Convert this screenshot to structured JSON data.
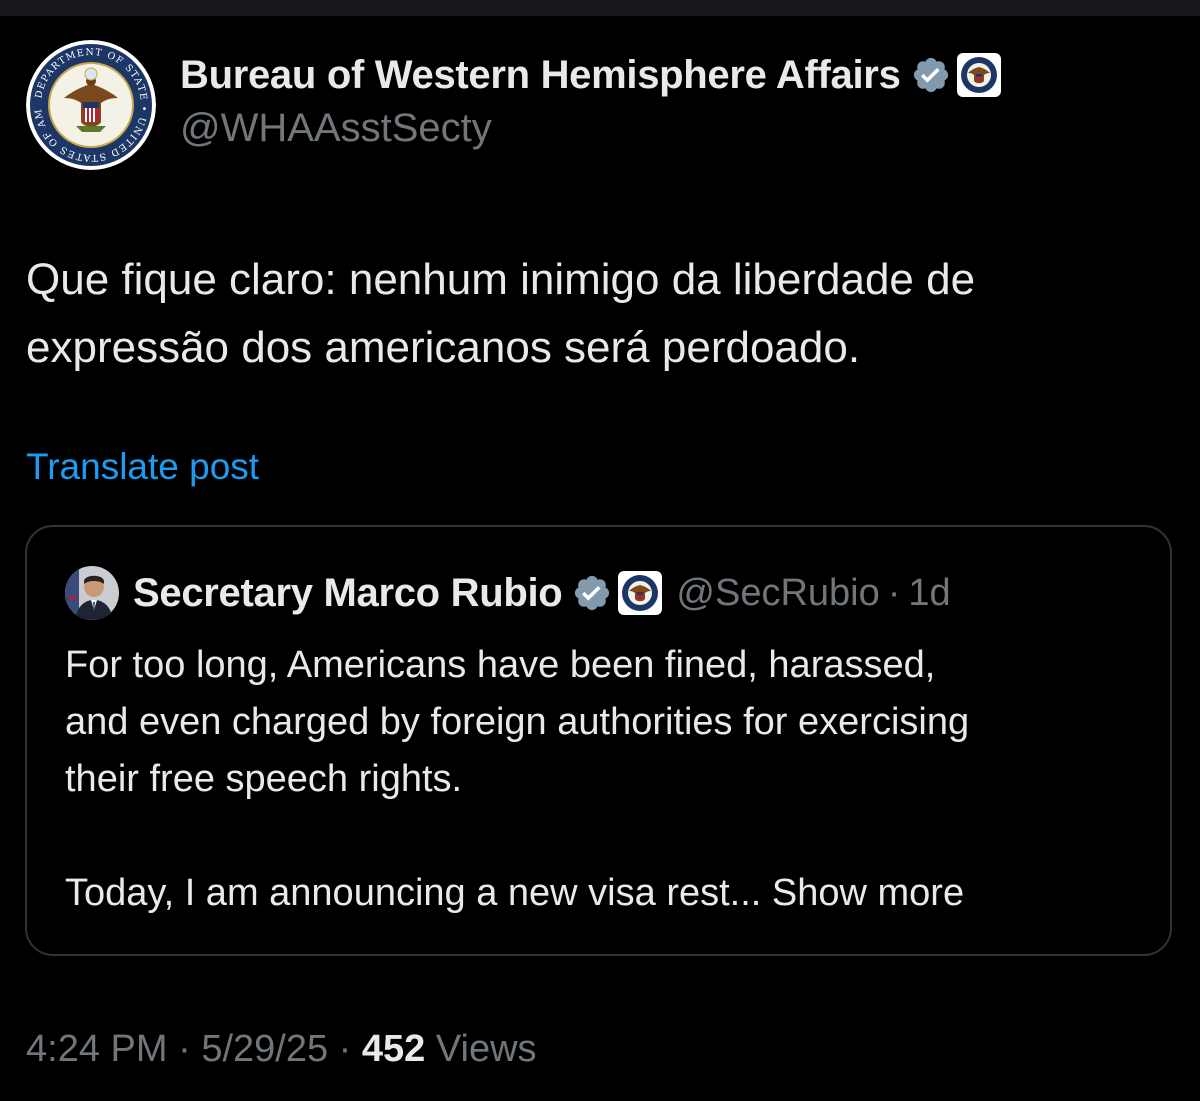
{
  "post": {
    "author": {
      "name": "Bureau of Western Hemisphere Affairs",
      "handle": "@WHAAsstSecty",
      "avatar_icon": "department-of-state-seal-icon",
      "avatar_ring_text": "DEPARTMENT OF STATE • UNITED STATES OF AMERICA",
      "verified_icon": "verified-badge-icon",
      "affiliation_icon": "state-department-seal-icon"
    },
    "text_line_1": "Que fique claro: nenhum inimigo da liberdade de",
    "text_line_2": "expressão dos americanos será perdoado.",
    "translate_label": "Translate post",
    "quoted": {
      "name": "Secretary Marco Rubio",
      "handle": "@SecRubio",
      "separator": "·",
      "time": "1d",
      "avatar_icon": "profile-photo-icon",
      "verified_icon": "verified-badge-icon",
      "affiliation_icon": "state-department-seal-icon",
      "text_line_1": "For too long, Americans have been fined, harassed,",
      "text_line_2": "and even charged by foreign authorities for exercising",
      "text_line_3": "their free speech rights.",
      "text_line_4": "Today, I am announcing a new visa rest... ",
      "show_more_label": "Show more"
    },
    "meta": {
      "time": "4:24 PM",
      "separator": "·",
      "date": "5/29/25",
      "views_count": "452",
      "views_label": "Views"
    }
  },
  "colors": {
    "background": "#000000",
    "text_primary": "#e7e9ea",
    "text_secondary": "#71767b",
    "link": "#1d9bf0",
    "verified_badge": "#829aab",
    "border": "#2f3336"
  }
}
